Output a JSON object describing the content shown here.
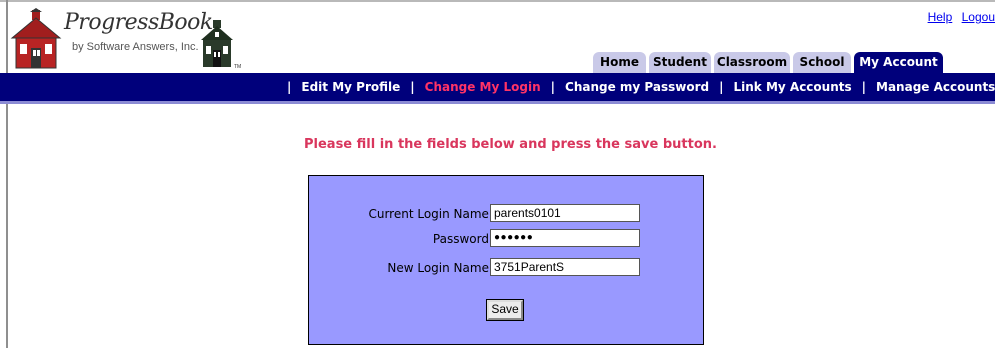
{
  "branding": {
    "logo_name": "ProgressBook",
    "logo_tagline": "by Software Answers, Inc.",
    "logo_tm": "TM"
  },
  "top_links": {
    "help": "Help",
    "logout": "Logou"
  },
  "tabs": [
    {
      "label": "Home",
      "active": false
    },
    {
      "label": "Student",
      "active": false
    },
    {
      "label": "Classroom",
      "active": false
    },
    {
      "label": "School",
      "active": false
    },
    {
      "label": "My Account",
      "active": true
    }
  ],
  "subnav": {
    "separator": "|",
    "items": [
      {
        "label": "Edit My Profile"
      },
      {
        "label": "Change My Login",
        "current": true
      },
      {
        "label": "Change my Password"
      },
      {
        "label": "Link My Accounts"
      },
      {
        "label": "Manage Accounts"
      }
    ]
  },
  "main": {
    "instruction": "Please fill in the fields below and press the save button."
  },
  "form": {
    "current_login_label": "Current Login Name:",
    "current_login_value": "parents0101",
    "password_label": "Password:",
    "password_value": "●●●●●●",
    "new_login_label": "New Login Name:",
    "new_login_value": "3751ParentS",
    "save_label": "Save"
  },
  "colors": {
    "nav_bar": "#00007b",
    "active_link": "#ff3366",
    "instruction": "#d9365d",
    "form_panel": "#9999ff",
    "tab_inactive": "#c9c9e8"
  }
}
